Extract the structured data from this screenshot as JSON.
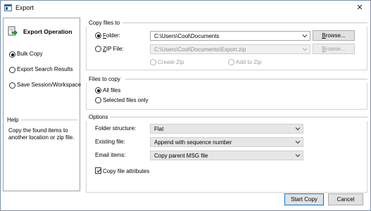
{
  "window": {
    "title": "Export",
    "close_glyph": "✕"
  },
  "left": {
    "operation_title": "Export Operation",
    "items": [
      {
        "label": "Bulk Copy",
        "selected": true
      },
      {
        "label": "Export Search Results",
        "selected": false
      },
      {
        "label": "Save Session/Workspace",
        "selected": false
      }
    ],
    "help_label": "Help",
    "help_text": "Copy the found items to another location or zip file."
  },
  "copy_files_to": {
    "group_label": "Copy files to",
    "folder": {
      "label_u": "F",
      "label_rest": "older:",
      "selected": true,
      "value": "C:\\Users\\Cool\\Documents",
      "browse_u": "B",
      "browse_rest": "rowse..."
    },
    "zip": {
      "label_u": "Z",
      "label_rest": "IP File:",
      "selected": false,
      "value": "C:\\Users\\Cool\\Documents\\Export.zip",
      "browse_u": "B",
      "browse_rest": "rowse..."
    },
    "create_zip": "Create Zip",
    "add_to_zip": "Add to Zip"
  },
  "files_to_copy": {
    "group_label": "Files to copy",
    "all_files": "All files",
    "selected_only": "Selected files only",
    "selection": "all"
  },
  "options": {
    "group_label": "Options",
    "folder_structure_label": "Folder structure:",
    "folder_structure_value": "Flat",
    "existing_file_label": "Existing file:",
    "existing_file_value": "Append with sequence number",
    "email_items_label": "Email items:",
    "email_items_value": "Copy parent MSG file",
    "copy_attributes_label": "Copy file attributes",
    "copy_attributes_checked": true
  },
  "footer": {
    "start_label": "Start Copy",
    "cancel_label": "Cancel"
  },
  "colors": {
    "accent": "#0078d7",
    "icon_blue": "#2a5aa8",
    "icon_green": "#2e9e3a"
  }
}
